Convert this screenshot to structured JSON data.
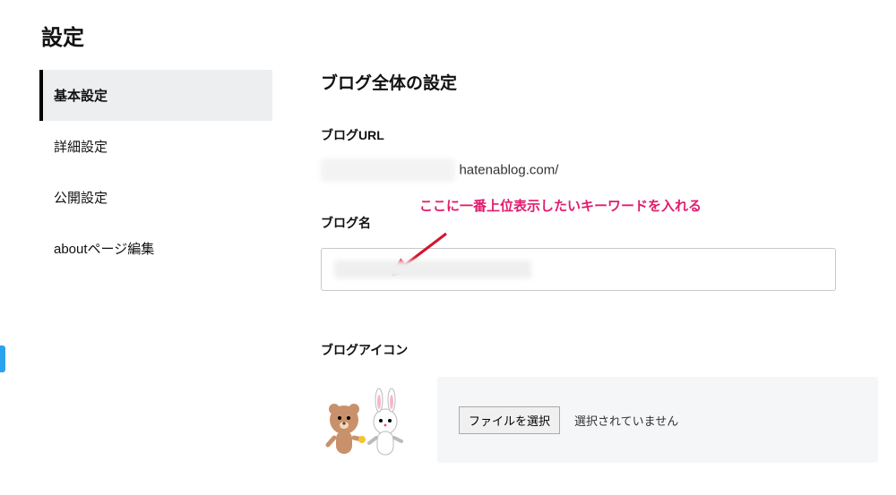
{
  "page_title": "設定",
  "sidebar": {
    "items": [
      {
        "label": "基本設定",
        "active": true
      },
      {
        "label": "詳細設定",
        "active": false
      },
      {
        "label": "公開設定",
        "active": false
      },
      {
        "label": "aboutページ編集",
        "active": false
      }
    ]
  },
  "main": {
    "section_title": "ブログ全体の設定",
    "url": {
      "label": "ブログURL",
      "suffix": "hatenablog.com/"
    },
    "name": {
      "label": "ブログ名",
      "annotation": "ここに一番上位表示したいキーワードを入れる"
    },
    "icon": {
      "label": "ブログアイコン",
      "choose_btn": "ファイルを選択",
      "no_file": "選択されていません"
    }
  }
}
